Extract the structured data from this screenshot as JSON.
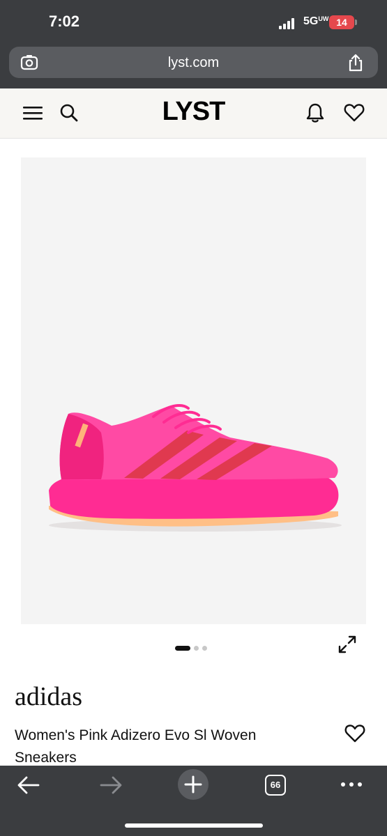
{
  "status_bar": {
    "time": "7:02",
    "network": "5G",
    "network_sub": "UW",
    "battery": "14"
  },
  "browser": {
    "url": "lyst.com",
    "tab_count": "66",
    "icons": [
      "lens-icon",
      "share-icon",
      "back-arrow-icon",
      "forward-arrow-icon",
      "plus-icon",
      "tabs-icon",
      "more-icon"
    ]
  },
  "site_header": {
    "logo": "LYST",
    "icons": [
      "menu-icon",
      "search-icon",
      "bell-icon",
      "heart-icon"
    ]
  },
  "product": {
    "brand": "adidas",
    "name": "Women's Pink Adizero Evo Sl Woven Sneakers",
    "image_alt": "pink running sneaker",
    "carousel": {
      "current": 1,
      "total": 3
    },
    "colors": {
      "shoe": "#ff2f8e",
      "stripes": "#e0394f",
      "sole_accent": "#ffc08a"
    }
  },
  "colors": {
    "browser_chrome": "#3b3d40",
    "header_bg": "#f7f6f3",
    "image_bg": "#f4f4f4"
  }
}
